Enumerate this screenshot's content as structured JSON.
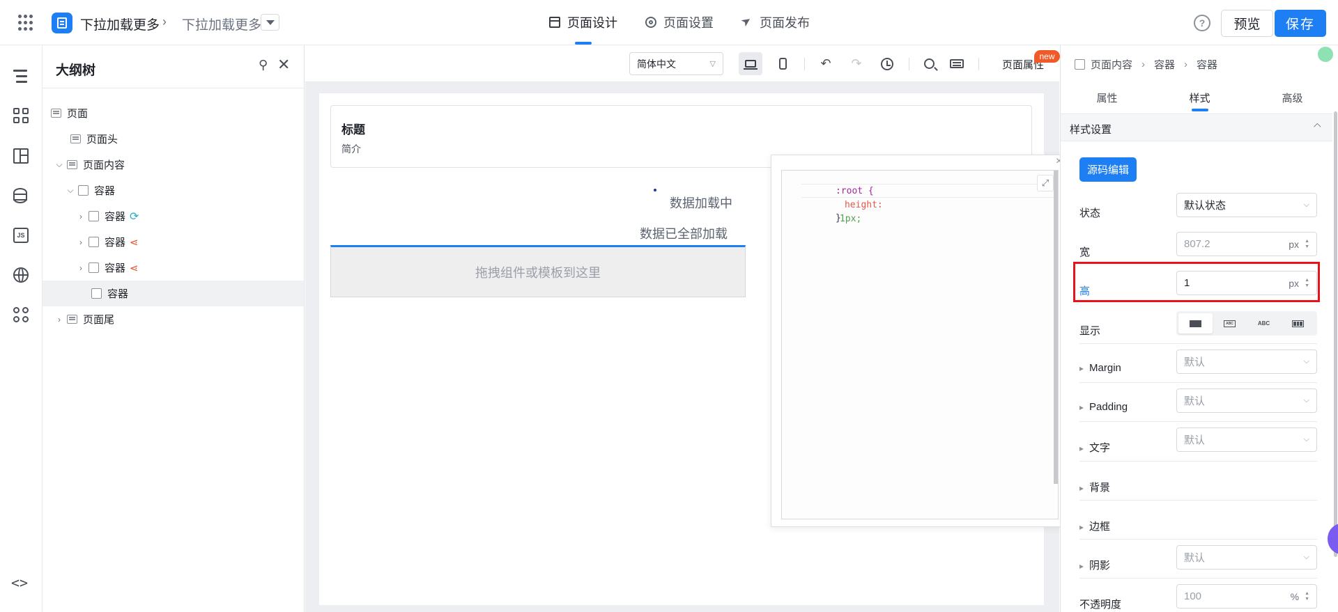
{
  "header": {
    "app_title": "下拉加载更多",
    "sub_title": "下拉加载更多",
    "tabs": [
      {
        "label": "页面设计",
        "icon": "layout-icon"
      },
      {
        "label": "页面设置",
        "icon": "gear-icon"
      },
      {
        "label": "页面发布",
        "icon": "send-icon"
      }
    ],
    "active_tab": "页面设计",
    "help_label": "?",
    "preview_label": "预览",
    "save_label": "保存"
  },
  "rail": {
    "icons": [
      "outline-tree-icon",
      "components-grid-icon",
      "layout-icon",
      "database-icon",
      "js-icon",
      "globe-icon",
      "apps-icon",
      "code-icon"
    ],
    "js_label": "JS",
    "code_label": "<>"
  },
  "outline": {
    "title": "大纲树",
    "pin_glyph": "📌",
    "close_glyph": "✕",
    "nodes": [
      {
        "label": "页面"
      },
      {
        "label": "页面头"
      },
      {
        "label": "页面内容"
      },
      {
        "label": "容器"
      },
      {
        "label": "容器"
      },
      {
        "label": "容器"
      },
      {
        "label": "容器"
      },
      {
        "label": "容器"
      },
      {
        "label": "页面尾"
      }
    ]
  },
  "toolbar": {
    "language": "简体中文",
    "page_props_label": "页面属性",
    "new_badge": "new"
  },
  "canvas": {
    "card_title": "标题",
    "card_subtitle": "简介",
    "loading_text": "数据加载中",
    "loaded_text": "数据已全部加载",
    "drop_text": "拖拽组件或模板到这里"
  },
  "editor": {
    "close_glyph": "×",
    "expand_glyph": "⤢",
    "code": {
      "selector": ":root {",
      "property": "height:",
      "value": "1px;",
      "close": "}"
    }
  },
  "props": {
    "breadcrumb": [
      "页面内容",
      "容器",
      "容器"
    ],
    "tabs": [
      "属性",
      "样式",
      "高级"
    ],
    "active_tab": "样式",
    "section_title": "样式设置",
    "source_edit_label": "源码编辑",
    "state_label": "状态",
    "state_value": "默认状态",
    "width_label": "宽",
    "width_value": "807.2",
    "width_unit": "px",
    "height_label": "高",
    "height_value": "1",
    "height_unit": "px",
    "display_label": "显示",
    "display_options": [
      "block",
      "inline",
      "ABC",
      "flex"
    ],
    "display_abc": "ABC",
    "display_abc_small": "ABC",
    "margin_label": "Margin",
    "margin_value": "默认",
    "padding_label": "Padding",
    "padding_value": "默认",
    "text_label": "文字",
    "text_value": "默认",
    "background_label": "背景",
    "border_label": "边框",
    "shadow_label": "阴影",
    "shadow_value": "默认",
    "opacity_label": "不透明度",
    "opacity_value": "100",
    "opacity_unit": "%"
  }
}
